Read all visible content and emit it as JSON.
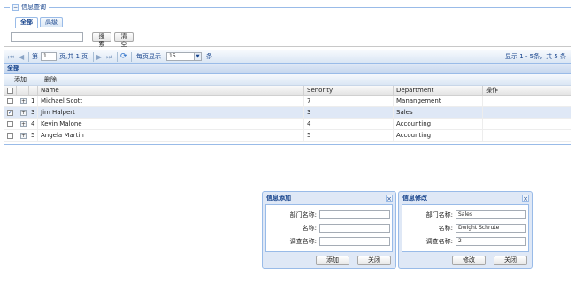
{
  "search_panel": {
    "legend": "信息查询",
    "collapse_glyph": "−",
    "tabs": [
      {
        "label": "全部",
        "active": true
      },
      {
        "label": "高级",
        "active": false
      }
    ],
    "search_value": "",
    "search_button": "搜索",
    "clear_button": "清空"
  },
  "pager": {
    "page_prefix": "第",
    "page_value": "1",
    "page_suffix": "页,共 1 页",
    "per_page_label": "每页显示",
    "per_page_value": "15",
    "per_page_unit": "条",
    "display_info": "显示 1 - 5条，共 5 条",
    "icons": {
      "first": "⏮",
      "prev": "◀",
      "next": "▶",
      "last": "⏭",
      "refresh": "⟳",
      "dropdown": "▼"
    }
  },
  "grid": {
    "title": "全部",
    "toolbar": {
      "add": "添加",
      "delete": "删除"
    },
    "columns": {
      "name": "Name",
      "seniority": "Senority",
      "department": "Department",
      "actions": "操作"
    },
    "rows": [
      {
        "num": "1",
        "name": "Michael Scott",
        "seniority": "7",
        "department": "Manangement",
        "checked": false
      },
      {
        "num": "3",
        "name": "Jim Halpert",
        "seniority": "3",
        "department": "Sales",
        "checked": true
      },
      {
        "num": "4",
        "name": "Kevin Malone",
        "seniority": "4",
        "department": "Accounting",
        "checked": false
      },
      {
        "num": "5",
        "name": "Angela Martin",
        "seniority": "5",
        "department": "Accounting",
        "checked": false
      }
    ],
    "expander_glyph": "+",
    "check_glyph": "✓"
  },
  "add_window": {
    "title": "信息添加",
    "close_glyph": "×",
    "fields": [
      {
        "label": "部门名称:",
        "value": ""
      },
      {
        "label": "名称:",
        "value": ""
      },
      {
        "label": "调查名称:",
        "value": ""
      }
    ],
    "ok_button": "添加",
    "close_button": "关闭"
  },
  "edit_window": {
    "title": "信息修改",
    "close_glyph": "×",
    "fields": [
      {
        "label": "部门名称:",
        "value": "Sales"
      },
      {
        "label": "名称:",
        "value": "Dwight Schrute"
      },
      {
        "label": "调查名称:",
        "value": "2"
      }
    ],
    "ok_button": "修改",
    "close_button": "关闭"
  }
}
